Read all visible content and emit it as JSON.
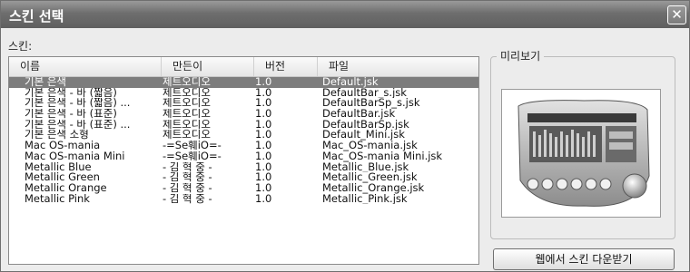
{
  "window": {
    "title": "스킨 선택",
    "close_symbol": "✕"
  },
  "list_label": "스킨:",
  "columns": [
    "이름",
    "만든이",
    "버전",
    "파일"
  ],
  "rows": [
    [
      "기본 은색",
      "제트오디오",
      "1.0",
      "Default.jsk"
    ],
    [
      "기본 은색 - 바 (짧음)",
      "제트오디오",
      "1.0",
      "DefaultBar_s.jsk"
    ],
    [
      "기본 은색 - 바 (짧음) ...",
      "제트오디오",
      "1.0",
      "DefaultBarSp_s.jsk"
    ],
    [
      "기본 은색 - 바 (표준)",
      "제트오디오",
      "1.0",
      "DefaultBar.jsk"
    ],
    [
      "기본 은색 - 바 (표준) ...",
      "제트오디오",
      "1.0",
      "DefaultBarSp.jsk"
    ],
    [
      "기본 은색 소형",
      "제트오디오",
      "1.0",
      "Default_Mini.jsk"
    ],
    [
      "Mac OS-mania",
      "-=Se훼iO=-",
      "1.0",
      "Mac_OS-mania.jsk"
    ],
    [
      "Mac OS-mania Mini",
      "-=Se훼iO=-",
      "1.0",
      "Mac_OS-mania Mini.jsk"
    ],
    [
      "Metallic Blue",
      "- 김 혁 중 -",
      "1.0",
      "Metallic_Blue.jsk"
    ],
    [
      "Metallic Green",
      "- 김 혁 중 -",
      "1.0",
      "Metallic_Green.jsk"
    ],
    [
      "Metallic Orange",
      "- 김 혁 중 -",
      "1.0",
      "Metallic_Orange.jsk"
    ],
    [
      "Metallic Pink",
      "- 김 혁 중 -",
      "1.0",
      "Metallic_Pink.jsk"
    ]
  ],
  "selected_row": 0,
  "preview_label": "미리보기",
  "download_label": "웹에서 스킨 다운받기",
  "colors": {
    "title_bar": "#6e6e6e",
    "selection": "#7d7d7d"
  }
}
